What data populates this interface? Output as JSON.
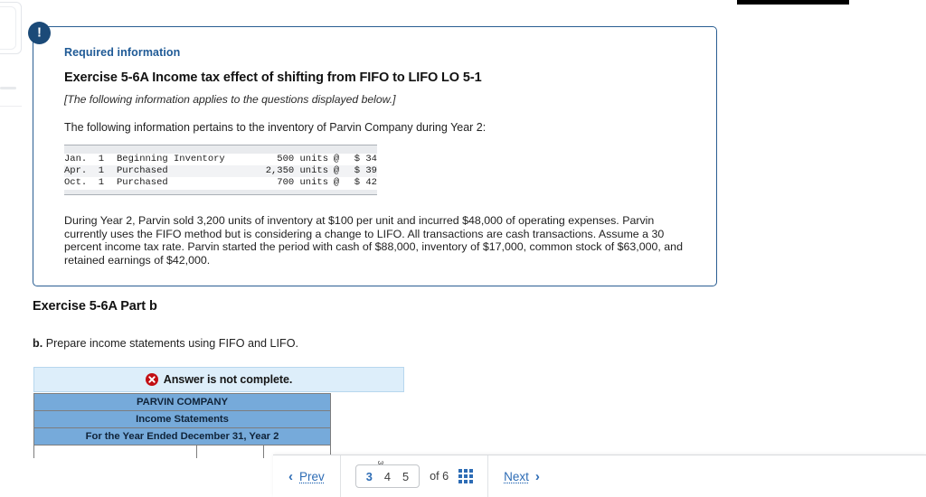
{
  "window": {
    "top_bar_color": "#000000",
    "accent_blue": "#1f5a96",
    "link_blue": "#2d6cb5",
    "table_header_blue": "#76aada",
    "banner_blue": "#ddeefa",
    "error_red": "#c20f14"
  },
  "required_info": {
    "badge_icon": "exclamation-icon",
    "kicker": "Required information",
    "title": "Exercise 5-6A Income tax effect of shifting from FIFO to LIFO LO 5-1",
    "italic_note": "[The following information applies to the questions displayed below.]",
    "lead": "The following information pertains to the inventory of Parvin Company during Year 2:",
    "inventory_rows": [
      {
        "date": "Jan.  1",
        "description": "Beginning Inventory",
        "units": "500 units",
        "at": "@",
        "price": "$ 34"
      },
      {
        "date": "Apr.  1",
        "description": "Purchased",
        "units": "2,350 units",
        "at": "@",
        "price": "$ 39"
      },
      {
        "date": "Oct.  1",
        "description": "Purchased",
        "units": "700 units",
        "at": "@",
        "price": "$ 42"
      }
    ],
    "body": "During Year 2, Parvin sold 3,200 units of inventory at $100 per unit and incurred $48,000 of operating expenses. Parvin currently uses the FIFO method but is considering a change to LIFO. All transactions are cash transactions. Assume a 30 percent income tax rate. Parvin started the period with cash of $88,000, inventory of $17,000, common stock of $63,000, and retained earnings of $42,000."
  },
  "part": {
    "heading": "Exercise 5-6A Part b",
    "prompt_label": "b.",
    "prompt_text": " Prepare income statements using FIFO and LIFO."
  },
  "answer_banner": {
    "icon": "error-x-circle-icon",
    "text": "Answer is not complete."
  },
  "income_statement": {
    "company": "PARVIN COMPANY",
    "statement": "Income Statements",
    "period": "For the Year Ended December 31, Year 2"
  },
  "footer": {
    "prev_label": "Prev",
    "prev_icon": "chevron-left-icon",
    "next_label": "Next",
    "next_icon": "chevron-right-icon",
    "grid_icon": "grid-menu-icon",
    "pages": [
      "3",
      "4",
      "5"
    ],
    "current_page": "3",
    "page_mark": "3",
    "of_label": "of 6"
  }
}
